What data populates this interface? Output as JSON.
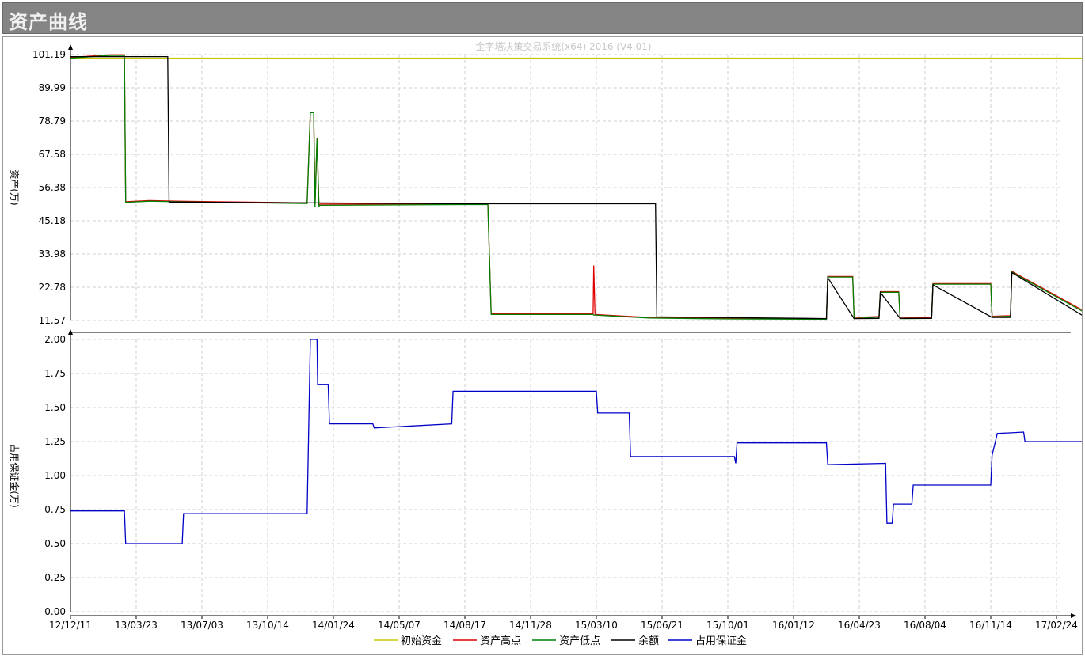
{
  "window": {
    "title": "资产曲线"
  },
  "chart_data": {
    "type": "line",
    "watermark": "金字塔决策交易系统(x64) 2016 (V4.01)",
    "x_tick_labels": [
      "12/12/11",
      "13/03/23",
      "13/07/03",
      "13/10/14",
      "14/01/24",
      "14/05/07",
      "14/08/17",
      "14/11/28",
      "15/03/10",
      "15/06/21",
      "15/10/01",
      "16/01/12",
      "16/04/23",
      "16/08/04",
      "16/11/14",
      "17/02/24"
    ],
    "grid": true,
    "legend_position": "bottom",
    "legend": [
      {
        "label": "初始资金",
        "color": "#c8c800"
      },
      {
        "label": "资产高点",
        "color": "#e00000"
      },
      {
        "label": "资产低点",
        "color": "#008000"
      },
      {
        "label": "余额",
        "color": "#000000"
      },
      {
        "label": "占用保证金",
        "color": "#0000c8"
      }
    ],
    "panels": [
      {
        "name": "asset",
        "ylabel": "资产(万)",
        "ylim": [
          11.57,
          101.19
        ],
        "y_ticks": [
          "101.19",
          "89.99",
          "78.79",
          "67.58",
          "56.38",
          "45.18",
          "33.98",
          "22.78",
          "11.57"
        ],
        "series": [
          {
            "name": "初始资金",
            "color": "#c8c800",
            "x": [
              0,
              15.4
            ],
            "y": [
              100.0,
              100.0
            ]
          },
          {
            "name": "资产高点",
            "color": "#e00000",
            "x": [
              0,
              0.6,
              0.82,
              0.84,
              1.2,
              1.6,
              3.6,
              3.65,
              3.7,
              3.72,
              3.75,
              3.78,
              3.8,
              6.35,
              6.4,
              7.95,
              7.96,
              7.98,
              8.8,
              10.0,
              11.5,
              11.52,
              11.9,
              11.92,
              12.3,
              12.32,
              12.6,
              12.62,
              13.1,
              13.12,
              14.0,
              14.02,
              14.3,
              14.32,
              15.4
            ],
            "y": [
              100.2,
              101.1,
              101.1,
              51.6,
              52.0,
              51.8,
              51.2,
              81.8,
              81.8,
              50.8,
              73.0,
              50.6,
              50.8,
              50.9,
              13.8,
              13.8,
              30.1,
              13.6,
              12.6,
              12.3,
              12.2,
              26.4,
              26.4,
              12.6,
              12.9,
              21.3,
              21.3,
              12.4,
              12.5,
              24.0,
              24.0,
              13.0,
              13.2,
              28.1,
              15.0
            ]
          },
          {
            "name": "资产低点",
            "color": "#008000",
            "x": [
              0,
              0.6,
              0.82,
              0.84,
              1.2,
              1.6,
              3.6,
              3.65,
              3.7,
              3.72,
              3.75,
              3.78,
              3.8,
              6.35,
              6.4,
              7.95,
              7.96,
              7.98,
              8.8,
              10.0,
              11.5,
              11.52,
              11.9,
              11.92,
              12.3,
              12.32,
              12.6,
              12.62,
              13.1,
              13.12,
              14.0,
              14.02,
              14.3,
              14.32,
              15.4
            ],
            "y": [
              100.0,
              100.9,
              100.9,
              51.4,
              51.8,
              51.6,
              51.0,
              81.6,
              81.6,
              49.8,
              72.8,
              50.2,
              50.4,
              50.7,
              13.6,
              13.6,
              13.4,
              13.4,
              12.4,
              12.1,
              12.0,
              26.2,
              26.2,
              12.2,
              12.7,
              21.1,
              21.1,
              12.2,
              12.3,
              23.8,
              23.8,
              12.8,
              13.0,
              27.9,
              14.6
            ]
          },
          {
            "name": "余额",
            "color": "#000000",
            "x": [
              0,
              1.48,
              1.5,
              6.0,
              8.9,
              8.92,
              11.5,
              11.52,
              11.92,
              12.3,
              12.32,
              12.62,
              13.1,
              13.12,
              14.02,
              14.3,
              14.32,
              15.4
            ],
            "y": [
              100.5,
              100.5,
              51.5,
              50.9,
              50.9,
              12.8,
              12.2,
              26.0,
              12.2,
              12.3,
              21.0,
              12.3,
              12.3,
              23.6,
              12.6,
              12.6,
              27.7,
              13.2
            ]
          }
        ]
      },
      {
        "name": "margin",
        "ylabel": "占用保证金(万)",
        "ylim": [
          0,
          2.0
        ],
        "y_ticks": [
          "2.00",
          "1.75",
          "1.50",
          "1.25",
          "1.00",
          "0.75",
          "0.50",
          "0.25",
          "0.00"
        ],
        "series": [
          {
            "name": "占用保证金",
            "color": "#0000c8",
            "x": [
              0,
              0.82,
              0.84,
              1.7,
              1.72,
              3.6,
              3.65,
              3.75,
              3.76,
              3.92,
              3.94,
              4.6,
              4.62,
              5.8,
              5.82,
              8.0,
              8.02,
              8.5,
              8.52,
              10.1,
              10.12,
              10.14,
              11.5,
              11.52,
              12.4,
              12.42,
              12.5,
              12.52,
              12.8,
              12.82,
              14.0,
              14.02,
              14.1,
              14.12,
              14.5,
              14.52,
              15.4
            ],
            "y": [
              0.74,
              0.74,
              0.5,
              0.5,
              0.72,
              0.72,
              2.0,
              2.0,
              1.67,
              1.67,
              1.38,
              1.38,
              1.35,
              1.38,
              1.62,
              1.62,
              1.46,
              1.46,
              1.14,
              1.14,
              1.09,
              1.24,
              1.24,
              1.08,
              1.09,
              0.65,
              0.65,
              0.79,
              0.79,
              0.93,
              0.93,
              1.15,
              1.31,
              1.31,
              1.32,
              1.25,
              1.25
            ]
          }
        ]
      }
    ]
  }
}
